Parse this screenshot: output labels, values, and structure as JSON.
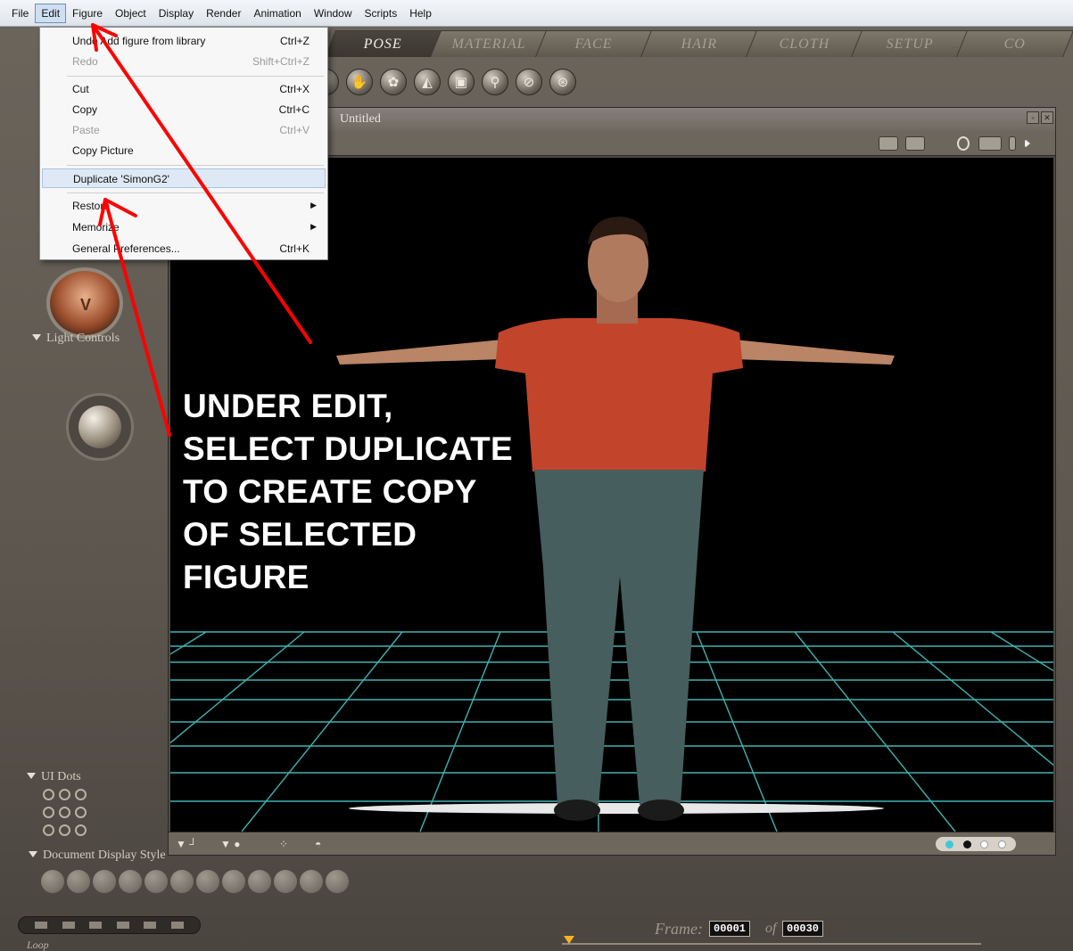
{
  "menubar": {
    "items": [
      "File",
      "Edit",
      "Figure",
      "Object",
      "Display",
      "Render",
      "Animation",
      "Window",
      "Scripts",
      "Help"
    ],
    "active": "Edit"
  },
  "edit_menu": {
    "items": [
      {
        "label": "Undo Add figure from library",
        "shortcut": "Ctrl+Z",
        "enabled": true
      },
      {
        "label": "Redo",
        "shortcut": "Shift+Ctrl+Z",
        "enabled": false
      },
      {
        "label": "Cut",
        "shortcut": "Ctrl+X",
        "enabled": true
      },
      {
        "label": "Copy",
        "shortcut": "Ctrl+C",
        "enabled": true
      },
      {
        "label": "Paste",
        "shortcut": "Ctrl+V",
        "enabled": false
      },
      {
        "label": "Copy Picture",
        "shortcut": "",
        "enabled": true
      },
      {
        "label": "Duplicate 'SimonG2'",
        "shortcut": "",
        "enabled": true,
        "highlighted": true
      },
      {
        "label": "Restore",
        "shortcut": "",
        "enabled": true,
        "submenu": true
      },
      {
        "label": "Memorize",
        "shortcut": "",
        "enabled": true,
        "submenu": true
      },
      {
        "label": "General Preferences...",
        "shortcut": "Ctrl+K",
        "enabled": true
      }
    ]
  },
  "room_tabs": [
    "POSE",
    "MATERIAL",
    "FACE",
    "HAIR",
    "CLOTH",
    "SETUP",
    "CO"
  ],
  "active_tab": "POSE",
  "left_panel": {
    "light_controls": "Light Controls",
    "ui_dots": "UI Dots",
    "document_display_style": "Document Display Style"
  },
  "document": {
    "title": "Untitled"
  },
  "instruction_text": [
    "UNDER EDIT,",
    "SELECT DUPLICATE",
    "TO CREATE COPY",
    "OF SELECTED",
    "FIGURE"
  ],
  "timeline": {
    "frame_label": "Frame:",
    "frame_value": "00001",
    "of_label": "of",
    "total_frames": "00030",
    "loop_label": "Loop"
  },
  "colors": {
    "annotation_arrow": "#ff0000",
    "grid": "#3fb3b1",
    "menu_highlight": "#dfe9f6"
  },
  "tool_icons": [
    "rotate-icon",
    "twist-icon",
    "translate-icon",
    "scale-icon",
    "taper-icon",
    "chain-break-icon",
    "color-icon",
    "grouping-icon",
    "view-magnifier-icon",
    "morph-brush-icon",
    "direct-manipulation-icon"
  ]
}
